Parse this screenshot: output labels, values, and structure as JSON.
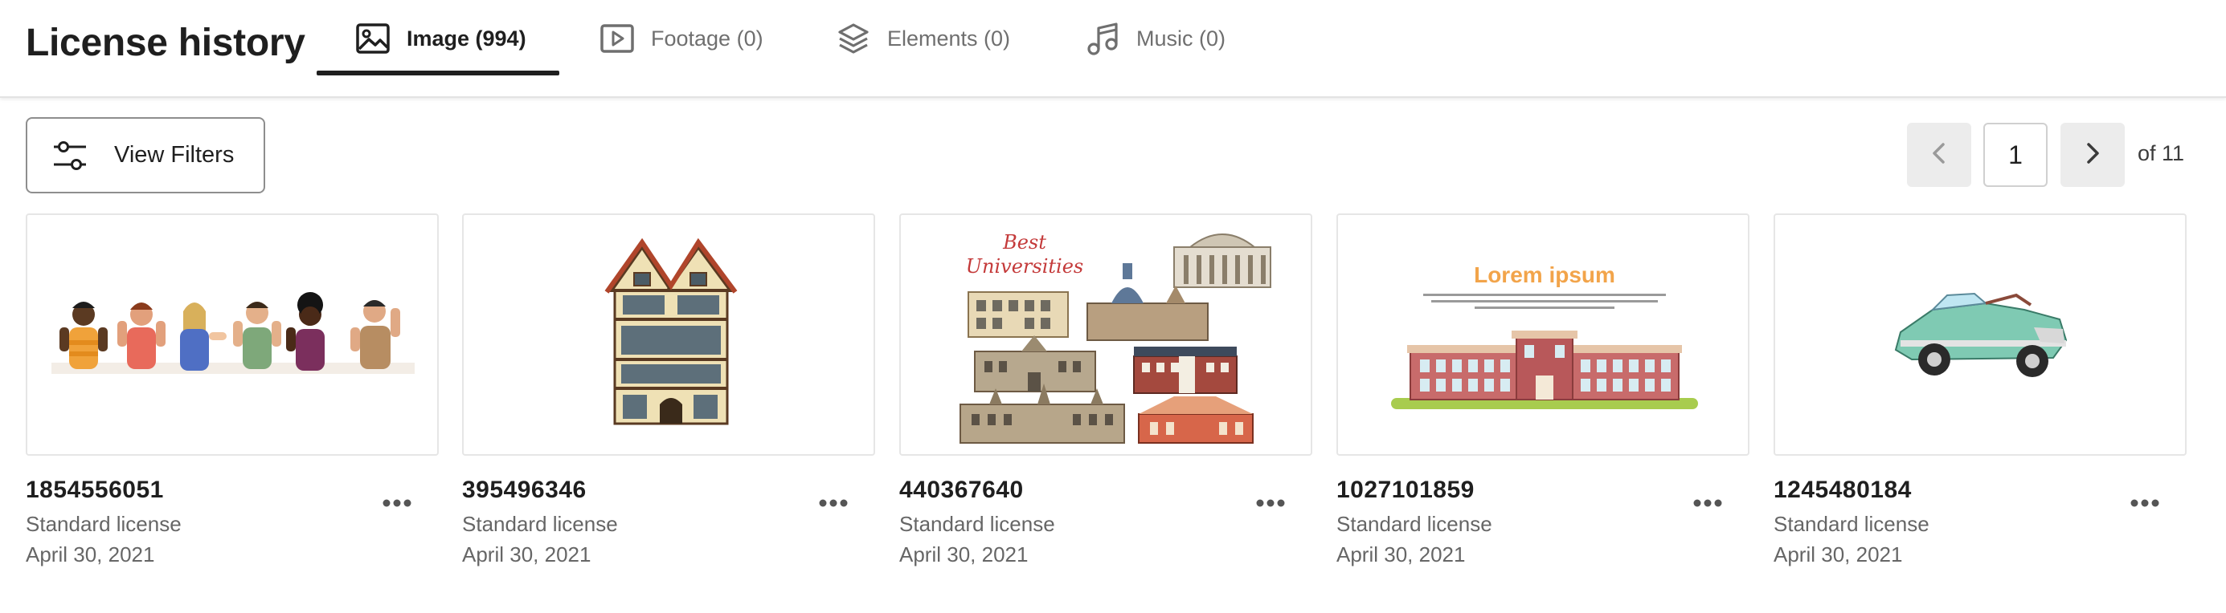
{
  "header": {
    "title": "License history",
    "tabs": [
      {
        "label": "Image (994)",
        "icon": "image-icon",
        "active": true
      },
      {
        "label": "Footage (0)",
        "icon": "video-play-icon",
        "active": false
      },
      {
        "label": "Elements (0)",
        "icon": "layers-icon",
        "active": false
      },
      {
        "label": "Music (0)",
        "icon": "music-note-icon",
        "active": false
      }
    ]
  },
  "toolbar": {
    "filters_label": "View Filters",
    "filters_icon": "sliders-icon"
  },
  "pagination": {
    "current_page": "1",
    "total_label": "of 11"
  },
  "cards": [
    {
      "id": "1854556051",
      "license": "Standard license",
      "date": "April 30, 2021",
      "thumbnail": "diverse-people-waving-illustration"
    },
    {
      "id": "395496346",
      "license": "Standard license",
      "date": "April 30, 2021",
      "thumbnail": "tudor-house-illustration"
    },
    {
      "id": "440367640",
      "license": "Standard license",
      "date": "April 30, 2021",
      "thumbnail": "best-universities-buildings-illustration",
      "thumbnail_text": [
        "Best",
        "Universities"
      ]
    },
    {
      "id": "1027101859",
      "license": "Standard license",
      "date": "April 30, 2021",
      "thumbnail": "school-building-lorem-ipsum-illustration",
      "thumbnail_text": [
        "Lorem ipsum"
      ]
    },
    {
      "id": "1245480184",
      "license": "Standard license",
      "date": "April 30, 2021",
      "thumbnail": "vintage-convertible-car-illustration"
    }
  ],
  "colors": {
    "accent": "#1f1f1f",
    "muted_text": "#666666",
    "pager_bg": "#ececec"
  }
}
